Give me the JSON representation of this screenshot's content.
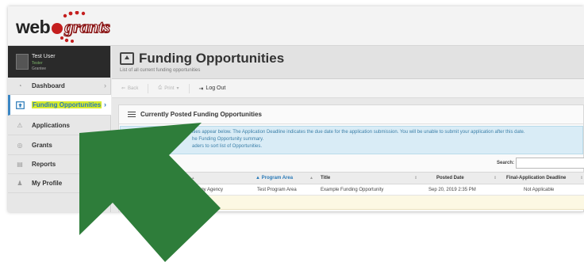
{
  "brand": {
    "logo_part1": "web",
    "logo_part2": "grants"
  },
  "user": {
    "name": "Test User",
    "role": "Tester",
    "dept": "Grantee"
  },
  "sidebar": {
    "items": [
      {
        "label": "Dashboard",
        "icon": "dashboard-icon",
        "chevron": true
      },
      {
        "label": "Funding Opportunities",
        "icon": "funding-icon",
        "chevron": true,
        "active": true
      },
      {
        "label": "Applications",
        "icon": "applications-icon"
      },
      {
        "label": "Grants",
        "icon": "grants-icon"
      },
      {
        "label": "Reports",
        "icon": "reports-icon"
      },
      {
        "label": "My Profile",
        "icon": "profile-icon"
      }
    ]
  },
  "page": {
    "title": "Funding Opportunities",
    "subtitle": "List of all current funding opportunities"
  },
  "toolbar": {
    "back": "Back",
    "print": "Print",
    "logout": "Log Out"
  },
  "panel": {
    "title": "Currently Posted Funding Opportunities",
    "info_line1": "ities appear below. The Application Deadline indicates the due date for the application submission. You will be unable to submit your application after this date.",
    "info_line2": "he Funding Opportunity summary.",
    "info_line3": "aders to sort list of Opportunities.",
    "search_label": "Search:"
  },
  "table": {
    "headers": [
      "Program Area",
      "Title",
      "Posted Date",
      "Final-Application Deadline"
    ],
    "rows": [
      {
        "agency": "nology Agency",
        "program_area": "Test Program Area",
        "title": "Example Funding Opportunity",
        "posted": "Sep 20, 2019 2:35 PM",
        "deadline": "Not Applicable"
      }
    ]
  },
  "colors": {
    "accent": "#2a7ab8",
    "arrow": "#2e7d3a",
    "highlight": "#d8ec2a",
    "info_bg": "#d9ecf6"
  }
}
